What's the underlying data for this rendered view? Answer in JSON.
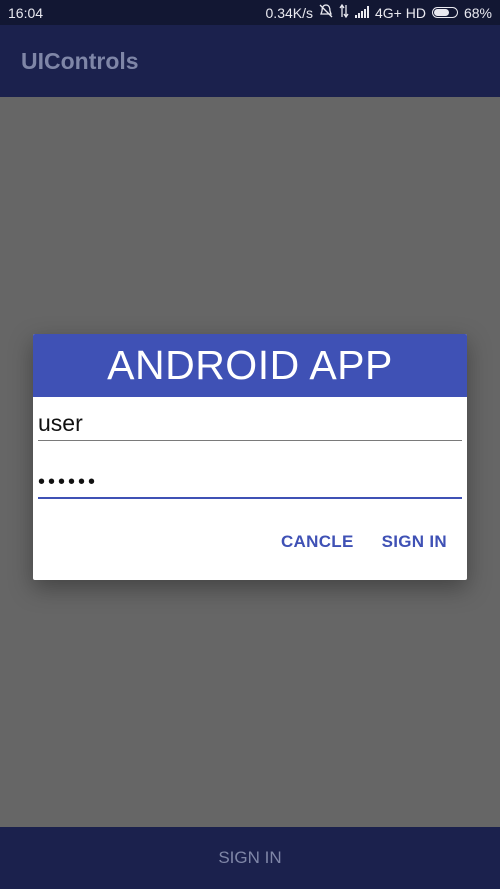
{
  "status_bar": {
    "time": "16:04",
    "speed": "0.34K/s",
    "network": "4G+ HD",
    "battery_text": "68%",
    "battery_level": 0.68
  },
  "app_bar": {
    "title": "UIControls"
  },
  "bottom_bar": {
    "sign_in_label": "SIGN IN"
  },
  "dialog": {
    "title": "ANDROID APP",
    "username_value": "user",
    "password_value": "••••••",
    "cancel_label": "CANCLE",
    "sign_in_label": "SIGN IN"
  },
  "colors": {
    "primary": "#3f51b5",
    "app_bar": "#1b214d",
    "status_bar": "#121733",
    "scrim": "#666666"
  }
}
